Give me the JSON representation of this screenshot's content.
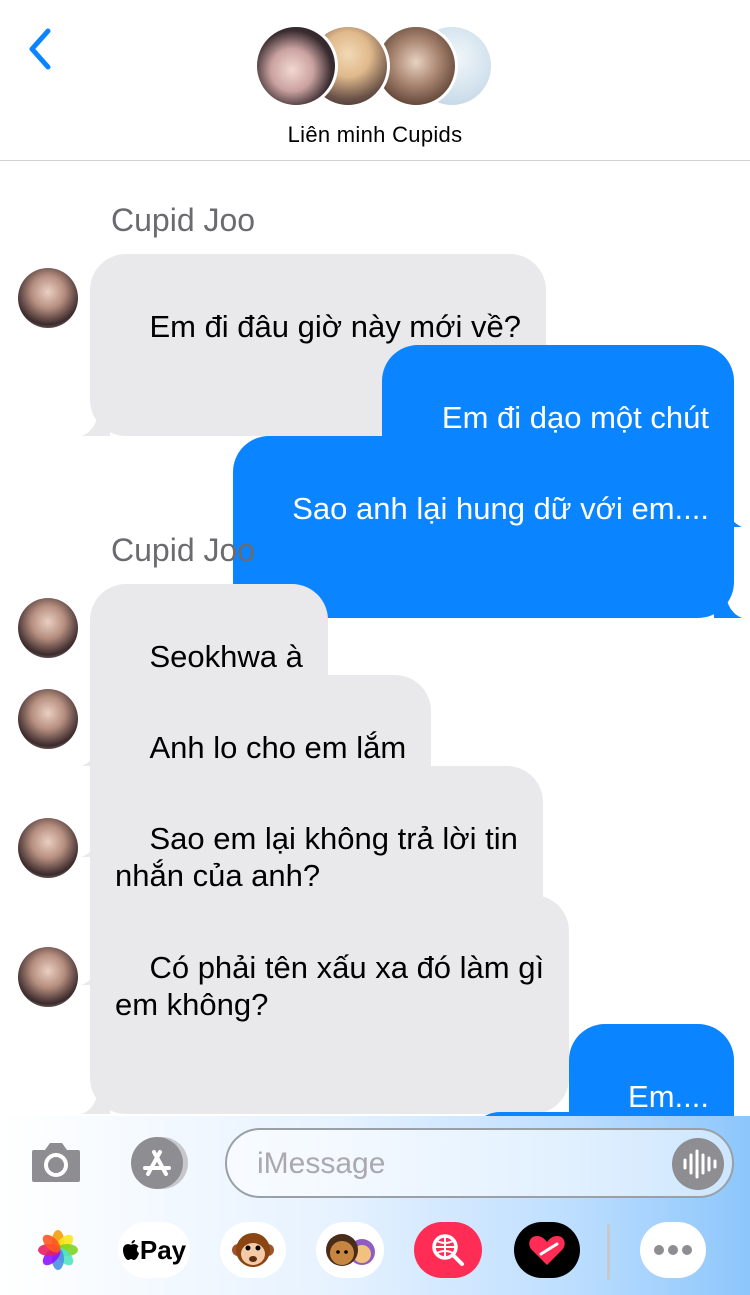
{
  "header": {
    "group_name": "Liên minh Cupids",
    "back_icon": "chevron-left-icon"
  },
  "messages": [
    {
      "sender": "Cupid Joo",
      "direction": "in",
      "text": "Em đi đâu giờ này mới về?"
    },
    {
      "direction": "out",
      "text": "Em đi dạo một chút"
    },
    {
      "direction": "out",
      "text": "Sao anh lại hung dữ với em...."
    },
    {
      "sender": "Cupid Joo",
      "direction": "in",
      "text": "Seokhwa à"
    },
    {
      "direction": "in",
      "text": "Anh lo cho em lắm"
    },
    {
      "direction": "in",
      "text": "Sao em lại không trả lời tin\nnhắn của anh?"
    },
    {
      "direction": "in",
      "text": "Có phải tên xấu xa đó làm gì\nem không?"
    },
    {
      "direction": "out",
      "text": "Em...."
    }
  ],
  "composer": {
    "placeholder": "iMessage",
    "camera_icon": "camera-icon",
    "appstore_icon": "app-store-icon",
    "audio_icon": "audio-waveform-icon"
  },
  "app_tray": {
    "pay_label": "Pay",
    "items": [
      "photos-icon",
      "apple-pay-icon",
      "monkey-animoji-icon",
      "memoji-icon",
      "image-search-icon",
      "digital-touch-icon",
      "more-icon"
    ]
  },
  "colors": {
    "outgoing_bubble": "#0a84ff",
    "incoming_bubble": "#e9e9eb",
    "accent": "#0a84ff"
  }
}
